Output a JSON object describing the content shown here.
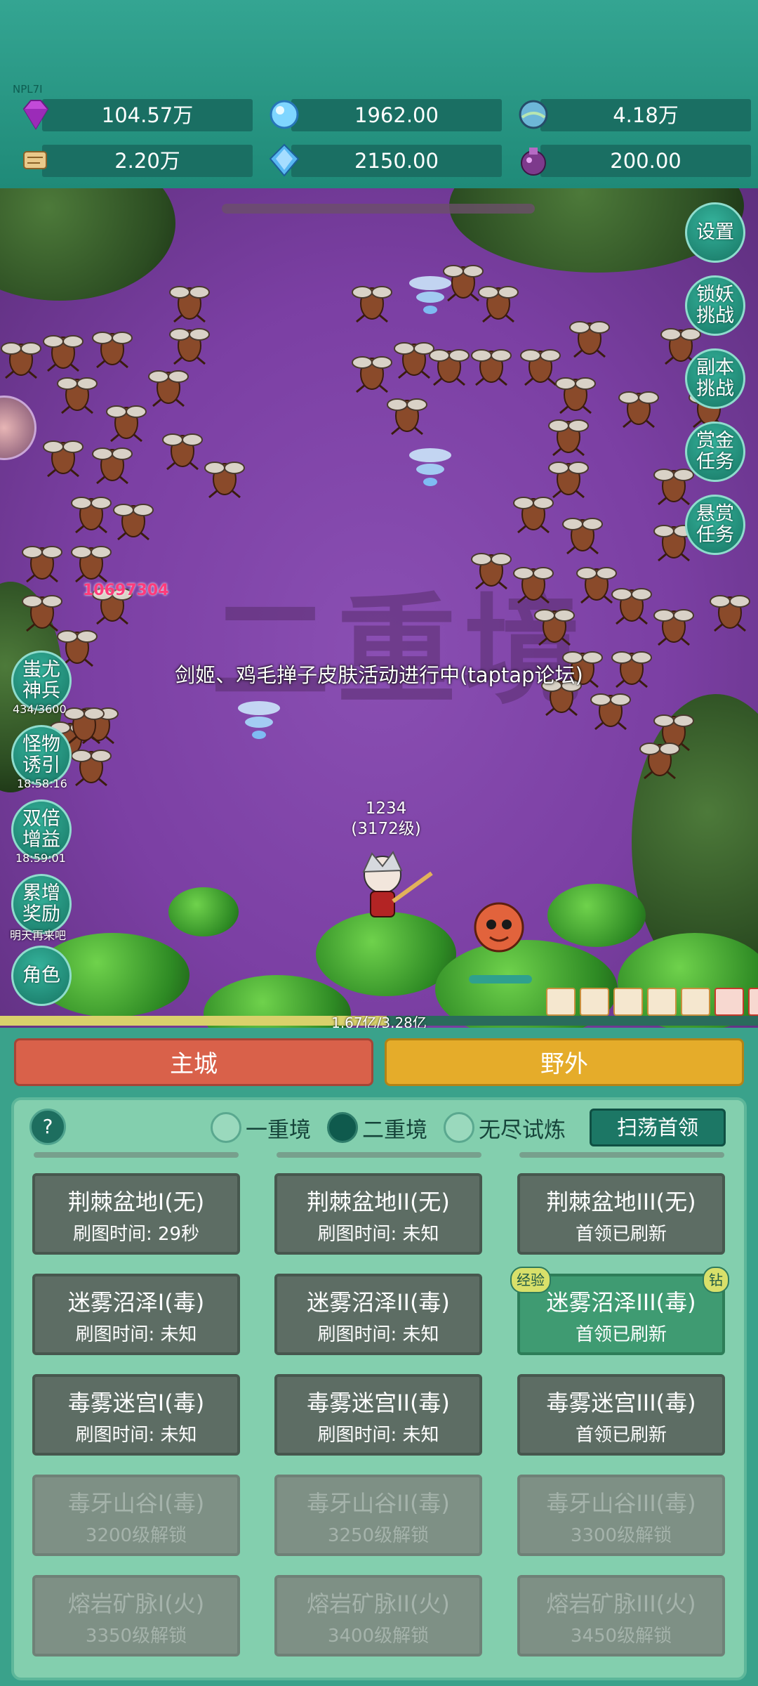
{
  "hud": {
    "watermark": "NPL7I",
    "resources": [
      {
        "icon": "purple-gem-icon",
        "value": "104.57万"
      },
      {
        "icon": "blue-crystal-icon",
        "value": "1962.00"
      },
      {
        "icon": "globe-orb-icon",
        "value": "4.18万"
      },
      {
        "icon": "scroll-icon",
        "value": "2.20万"
      },
      {
        "icon": "diamond-icon",
        "value": "2150.00"
      },
      {
        "icon": "potion-bag-icon",
        "value": "200.00"
      }
    ]
  },
  "field": {
    "background_text": "二重境",
    "announcement": "剑姬、鸡毛掸子皮肤活动进行中(taptap论坛)",
    "damage_number": "10697304",
    "player": {
      "name": "1234",
      "level": "(3172级)"
    },
    "boss_hp": {
      "text": "1.67亿/3.28亿",
      "fraction": 0.51
    }
  },
  "right_buttons": [
    "设置",
    "锁妖挑战",
    "副本挑战",
    "赏金任务",
    "悬赏任务"
  ],
  "left_buttons": [
    {
      "label": "蚩尤神兵",
      "sub": "434/3600"
    },
    {
      "label": "怪物诱引",
      "sub": "18:58:16"
    },
    {
      "label": "双倍增益",
      "sub": "18:59:01"
    },
    {
      "label": "累增奖励",
      "sub": "明天再来吧"
    },
    {
      "label": "角色",
      "sub": ""
    }
  ],
  "tabs": {
    "main_city": "主城",
    "wild": "野外"
  },
  "realm": {
    "help": "?",
    "options": [
      {
        "label": "一重境",
        "selected": false
      },
      {
        "label": "二重境",
        "selected": true
      },
      {
        "label": "无尽试炼",
        "selected": false
      }
    ],
    "sweep_button": "扫荡首领"
  },
  "maps": [
    {
      "title": "荆棘盆地I(无)",
      "status": "刷图时间: 29秒",
      "state": "normal"
    },
    {
      "title": "荆棘盆地II(无)",
      "status": "刷图时间: 未知",
      "state": "normal"
    },
    {
      "title": "荆棘盆地III(无)",
      "status": "首领已刷新",
      "state": "normal"
    },
    {
      "title": "迷雾沼泽I(毒)",
      "status": "刷图时间: 未知",
      "state": "normal"
    },
    {
      "title": "迷雾沼泽II(毒)",
      "status": "刷图时间: 未知",
      "state": "normal"
    },
    {
      "title": "迷雾沼泽III(毒)",
      "status": "首领已刷新",
      "state": "active",
      "badge_left": "经验",
      "badge_right": "钻"
    },
    {
      "title": "毒雾迷宫I(毒)",
      "status": "刷图时间: 未知",
      "state": "normal"
    },
    {
      "title": "毒雾迷宫II(毒)",
      "status": "刷图时间: 未知",
      "state": "normal"
    },
    {
      "title": "毒雾迷宫III(毒)",
      "status": "首领已刷新",
      "state": "normal"
    },
    {
      "title": "毒牙山谷I(毒)",
      "status": "3200级解锁",
      "state": "locked"
    },
    {
      "title": "毒牙山谷II(毒)",
      "status": "3250级解锁",
      "state": "locked"
    },
    {
      "title": "毒牙山谷III(毒)",
      "status": "3300级解锁",
      "state": "locked"
    },
    {
      "title": "熔岩矿脉I(火)",
      "status": "3350级解锁",
      "state": "locked"
    },
    {
      "title": "熔岩矿脉II(火)",
      "status": "3400级解锁",
      "state": "locked"
    },
    {
      "title": "熔岩矿脉III(火)",
      "status": "3450级解锁",
      "state": "locked"
    }
  ],
  "colors": {
    "main_city": "#d9614a",
    "wild": "#e5ac2a",
    "panel": "#83cfae",
    "field": "#7b3fa3"
  }
}
